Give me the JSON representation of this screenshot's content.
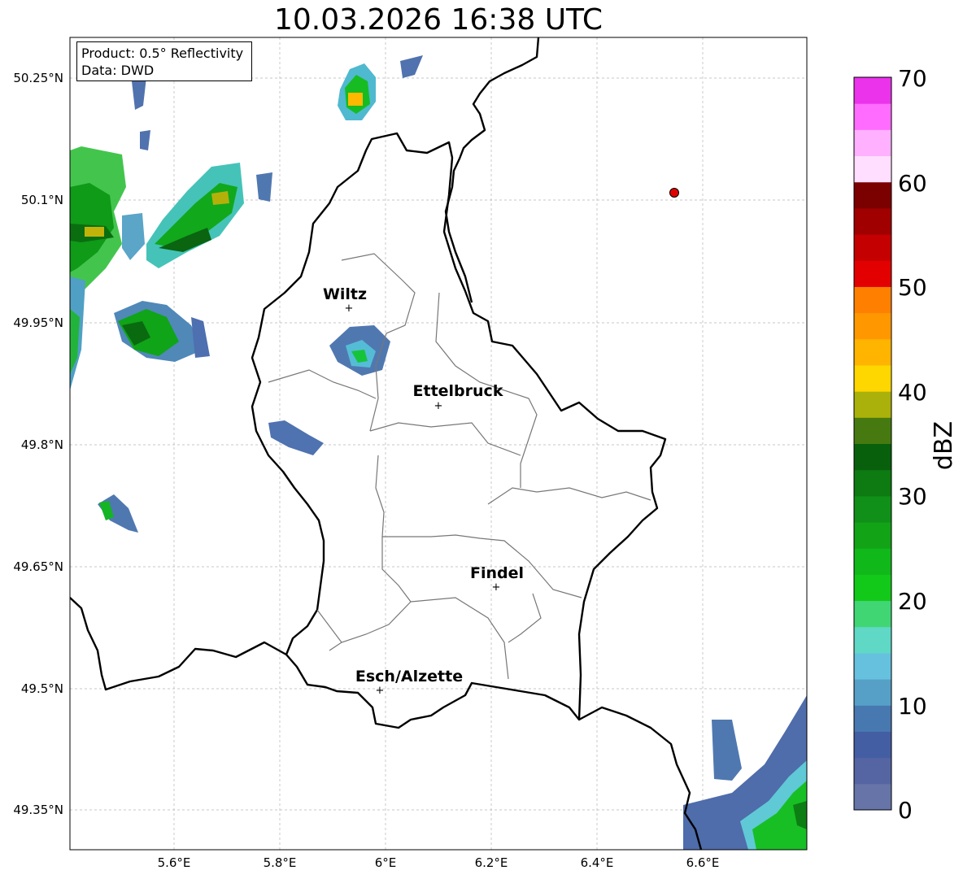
{
  "title": "10.03.2026 16:38 UTC",
  "info": {
    "product": "Product: 0.5° Reflectivity",
    "source": "Data: DWD"
  },
  "axes": {
    "lat_ticks": [
      "50.25°N",
      "50.1°N",
      "49.95°N",
      "49.8°N",
      "49.65°N",
      "49.5°N",
      "49.35°N"
    ],
    "lon_ticks": [
      "5.6°E",
      "5.8°E",
      "6°E",
      "6.2°E",
      "6.4°E",
      "6.6°E"
    ]
  },
  "cities": [
    {
      "name": "Wiltz",
      "lon": 5.93,
      "lat": 49.966
    },
    {
      "name": "Ettelbruck",
      "lon": 6.104,
      "lat": 49.847
    },
    {
      "name": "Findel",
      "lon": 6.208,
      "lat": 49.623
    },
    {
      "name": "Esch/Alzette",
      "lon": 5.987,
      "lat": 49.496
    }
  ],
  "marker": {
    "lon": 6.545,
    "lat": 50.111,
    "color": "#e00000"
  },
  "colorbar": {
    "label": "dBZ",
    "ticks": [
      "0",
      "10",
      "20",
      "30",
      "40",
      "50",
      "60",
      "70"
    ],
    "colors": [
      "#6674a8",
      "#5565a3",
      "#435ea2",
      "#4878b0",
      "#56a0c8",
      "#66c1de",
      "#60d8c6",
      "#40d674",
      "#12c91a",
      "#11b81a",
      "#12a316",
      "#109018",
      "#0d7a12",
      "#08600c",
      "#467a10",
      "#aab10a",
      "#fed700",
      "#ffb400",
      "#ff9800",
      "#ff8000",
      "#e30000",
      "#c40000",
      "#a00000",
      "#7b0000",
      "#ffdeff",
      "#ffb0ff",
      "#ff6cff",
      "#ea33ea"
    ]
  }
}
